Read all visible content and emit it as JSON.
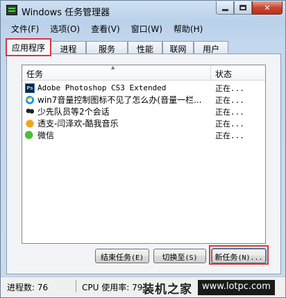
{
  "window": {
    "title": "Windows 任务管理器",
    "min_glyph": "",
    "max_glyph": "",
    "close_glyph": "✕"
  },
  "menu": [
    "文件(F)",
    "选项(O)",
    "查看(V)",
    "窗口(W)",
    "帮助(H)"
  ],
  "tabs": [
    "应用程序",
    "进程",
    "服务",
    "性能",
    "联网",
    "用户"
  ],
  "active_tab": "应用程序",
  "list": {
    "col_task": "任务",
    "col_status": "状态",
    "rows": [
      {
        "icon": "photoshop-icon",
        "task": "Adobe Photoshop CS3 Extended",
        "status": "正在...",
        "mono": true
      },
      {
        "icon": "ie-icon",
        "task": "win7音量控制图标不见了怎么办(音量一栏...",
        "status": "正在...",
        "mono": false
      },
      {
        "icon": "qq-icon",
        "task": "少先队员等2个会话",
        "status": "正在...",
        "mono": false
      },
      {
        "icon": "music-icon",
        "task": "透支-闫泽欢-酷我音乐",
        "status": "正在...",
        "mono": false
      },
      {
        "icon": "wechat-icon",
        "task": "微信",
        "status": "正在...",
        "mono": false
      }
    ]
  },
  "buttons": {
    "end_task": "结束任务",
    "end_task_key": "(E)",
    "switch_to": "切换至",
    "switch_to_key": "(S)",
    "new_task": "新任务",
    "new_task_key": "(N)..."
  },
  "statusbar": {
    "processes": "进程数: 76",
    "cpu": "CPU 使用率: 79",
    "watermark_logo": "装机之家",
    "watermark_url": "www.lotpc.com"
  },
  "colors": {
    "highlight_red": "#d9363e",
    "photoshop_blue": "#0c2740",
    "wechat_green": "#4cbf3b"
  }
}
